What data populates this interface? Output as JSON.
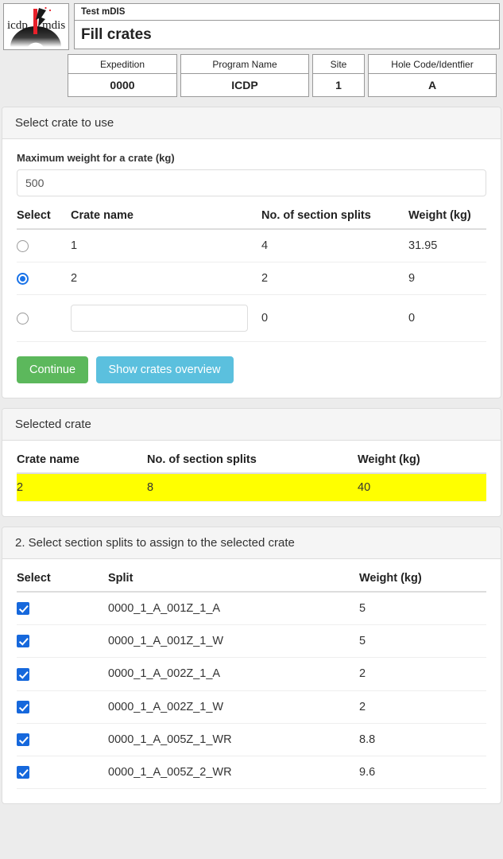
{
  "header": {
    "logo_alt": "icdp mdis logo",
    "logo_text_left": "icdp",
    "logo_text_right": "mdis",
    "subtitle": "Test mDIS",
    "title": "Fill crates"
  },
  "info_table": {
    "headers": [
      "Expedition",
      "Program Name",
      "Site",
      "Hole Code/Identfier"
    ],
    "values": [
      "0000",
      "ICDP",
      "1",
      "A"
    ]
  },
  "select_crate_panel": {
    "heading": "Select crate to use",
    "max_weight_label": "Maximum weight for a crate (kg)",
    "max_weight_value": "500",
    "max_weight_placeholder": "",
    "table": {
      "headers": [
        "Select",
        "Crate name",
        "No. of section splits",
        "Weight (kg)"
      ],
      "rows": [
        {
          "selected": false,
          "is_input": false,
          "crate_name": "1",
          "splits": "4",
          "weight": "31.95"
        },
        {
          "selected": true,
          "is_input": false,
          "crate_name": "2",
          "splits": "2",
          "weight": "9"
        },
        {
          "selected": false,
          "is_input": true,
          "crate_name": "",
          "new_crate_placeholder": "",
          "splits": "0",
          "weight": "0"
        }
      ]
    },
    "buttons": {
      "continue": "Continue",
      "show_overview": "Show crates overview"
    }
  },
  "selected_crate_panel": {
    "heading": "Selected crate",
    "table": {
      "headers": [
        "Crate name",
        "No. of section splits",
        "Weight (kg)"
      ],
      "row": {
        "crate_name": "2",
        "splits": "8",
        "weight": "40"
      }
    }
  },
  "section_splits_panel": {
    "heading": "2. Select section splits to assign to the selected crate",
    "table": {
      "headers": [
        "Select",
        "Split",
        "Weight (kg)"
      ],
      "rows": [
        {
          "checked": true,
          "split": "0000_1_A_001Z_1_A",
          "weight": "5"
        },
        {
          "checked": true,
          "split": "0000_1_A_001Z_1_W",
          "weight": "5"
        },
        {
          "checked": true,
          "split": "0000_1_A_002Z_1_A",
          "weight": "2"
        },
        {
          "checked": true,
          "split": "0000_1_A_002Z_1_W",
          "weight": "2"
        },
        {
          "checked": true,
          "split": "0000_1_A_005Z_1_WR",
          "weight": "8.8"
        },
        {
          "checked": true,
          "split": "0000_1_A_005Z_2_WR",
          "weight": "9.6"
        }
      ]
    }
  },
  "colors": {
    "page_bg": "#ececec",
    "panel_heading_bg": "#f5f5f5",
    "highlight_row": "#ffff00",
    "continue_button": "#5cb85c",
    "overview_button": "#5bc0de",
    "control_accent": "#1668dc",
    "logo_red": "#e8202a"
  }
}
